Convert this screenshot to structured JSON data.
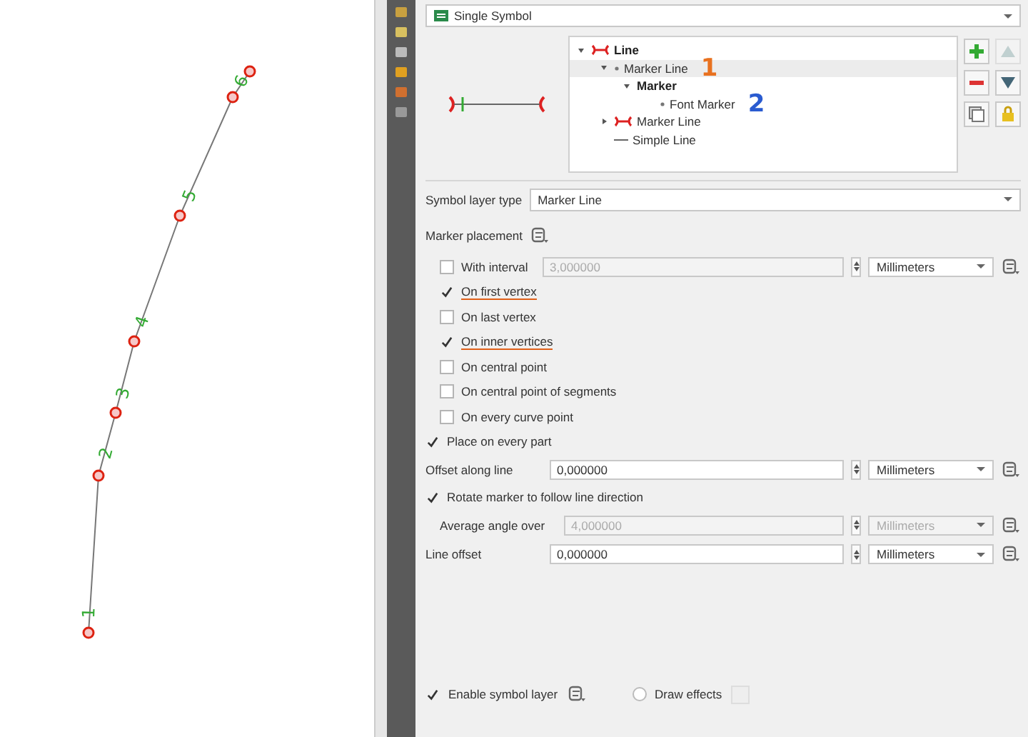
{
  "map": {
    "labels": [
      "1",
      "2",
      "3",
      "4",
      "5",
      "6"
    ]
  },
  "renderer": {
    "value": "Single Symbol"
  },
  "layer_tree": [
    {
      "label": "Line",
      "kind": "line-symbol",
      "expanded": true,
      "selected": false,
      "children": [
        {
          "label": "Marker Line",
          "kind": "sub-layer",
          "expanded": true,
          "selected": true,
          "annotation": {
            "text": "1",
            "color": "#e8711f"
          },
          "children": [
            {
              "label": "Marker",
              "kind": "marker-symbol",
              "expanded": true,
              "selected": false,
              "children": [
                {
                  "label": "Font Marker",
                  "kind": "sub-layer",
                  "selected": false,
                  "annotation": {
                    "text": "2",
                    "color": "#2a5bd0"
                  }
                }
              ]
            }
          ]
        },
        {
          "label": "Marker Line",
          "kind": "marker-line",
          "expanded": false,
          "selected": false
        },
        {
          "label": "Simple Line",
          "kind": "simple-line",
          "selected": false
        }
      ]
    }
  ],
  "layer_buttons": [
    {
      "kind": "add",
      "disabled": false
    },
    {
      "kind": "move-up",
      "disabled": true
    },
    {
      "kind": "remove",
      "disabled": false
    },
    {
      "kind": "move-down",
      "disabled": false
    },
    {
      "kind": "duplicate",
      "disabled": false
    },
    {
      "kind": "lock",
      "disabled": false
    }
  ],
  "symbol_layer_type": {
    "label": "Symbol layer type",
    "value": "Marker Line"
  },
  "marker_placement": {
    "label": "Marker placement"
  },
  "placement_options": [
    {
      "label": "With interval",
      "checked": false,
      "kind": "interval",
      "value": "3,000000",
      "unit": "Millimeters",
      "disabled": true
    },
    {
      "label": "On first vertex",
      "checked": true,
      "kind": "plain",
      "underlined": true
    },
    {
      "label": "On last vertex",
      "checked": false,
      "kind": "plain",
      "underlined": false
    },
    {
      "label": "On inner vertices",
      "checked": true,
      "kind": "plain",
      "underlined": true
    },
    {
      "label": "On central point",
      "checked": false,
      "kind": "plain",
      "underlined": false
    },
    {
      "label": "On central point of segments",
      "checked": false,
      "kind": "plain",
      "underlined": false
    },
    {
      "label": "On every curve point",
      "checked": false,
      "kind": "plain",
      "underlined": false
    }
  ],
  "place_on_every_part": {
    "label": "Place on every part",
    "checked": true
  },
  "offset_along_line": {
    "label": "Offset along line",
    "value": "0,000000",
    "unit": "Millimeters",
    "disabled": false
  },
  "rotate_marker": {
    "label": "Rotate marker to follow line direction",
    "checked": true
  },
  "average_angle": {
    "label": "Average angle over",
    "value": "4,000000",
    "unit": "Millimeters",
    "disabled": true
  },
  "line_offset": {
    "label": "Line offset",
    "value": "0,000000",
    "unit": "Millimeters",
    "disabled": false
  },
  "footer": {
    "enable_layer": {
      "label": "Enable symbol layer",
      "checked": true
    },
    "draw_effects": {
      "label": "Draw effects",
      "checked": false
    }
  }
}
